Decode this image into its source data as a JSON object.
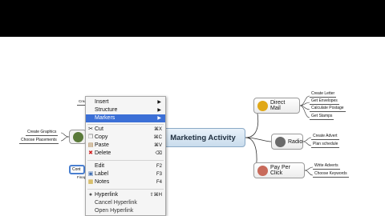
{
  "map": {
    "central": "Marketing Activity",
    "topics": [
      {
        "label": "Direct Mail",
        "icon": "direct-mail-icon",
        "color": "#e0a818",
        "subs": [
          "Create Letter",
          "Get Envelopes",
          "Calculate Postage",
          "Get Stamps"
        ]
      },
      {
        "label": "Radio",
        "icon": "radio-icon",
        "color": "#6a6a6a",
        "subs": [
          "Create Advert",
          "Plan schedule"
        ]
      },
      {
        "label": "Pay Per Click",
        "icon": "pay-per-click-icon",
        "color": "#c86a5a",
        "subs": [
          "Write Adverts",
          "Choose Keywords"
        ]
      }
    ],
    "left_subs": [
      "Create Graphics",
      "Choose Placements"
    ],
    "partial_labels": {
      "top": "Create",
      "mid": "Cont",
      "bottom": "Finap"
    }
  },
  "menu": {
    "items": [
      {
        "label": "Insert",
        "arrow": "▶"
      },
      {
        "label": "Structure",
        "arrow": "▶"
      },
      {
        "label": "Markers",
        "arrow": "▶",
        "highlighted": true
      },
      {
        "label": "Cut",
        "shortcut": "⌘X",
        "icon": "scissors-icon"
      },
      {
        "label": "Copy",
        "shortcut": "⌘C",
        "icon": "copy-icon"
      },
      {
        "label": "Paste",
        "shortcut": "⌘V",
        "icon": "paste-icon"
      },
      {
        "label": "Delete",
        "shortcut": "⌫",
        "icon": "delete-icon"
      },
      {
        "label": "Edit",
        "shortcut": "F2"
      },
      {
        "label": "Label",
        "shortcut": "F3",
        "icon": "label-icon"
      },
      {
        "label": "Notes",
        "shortcut": "F4",
        "icon": "notes-icon"
      },
      {
        "label": "Hyperlink",
        "shortcut": "⇧⌘H",
        "icon": "hyperlink-icon"
      },
      {
        "label": "Cancel Hyperlink"
      },
      {
        "label": "Open Hyperlink"
      }
    ]
  }
}
